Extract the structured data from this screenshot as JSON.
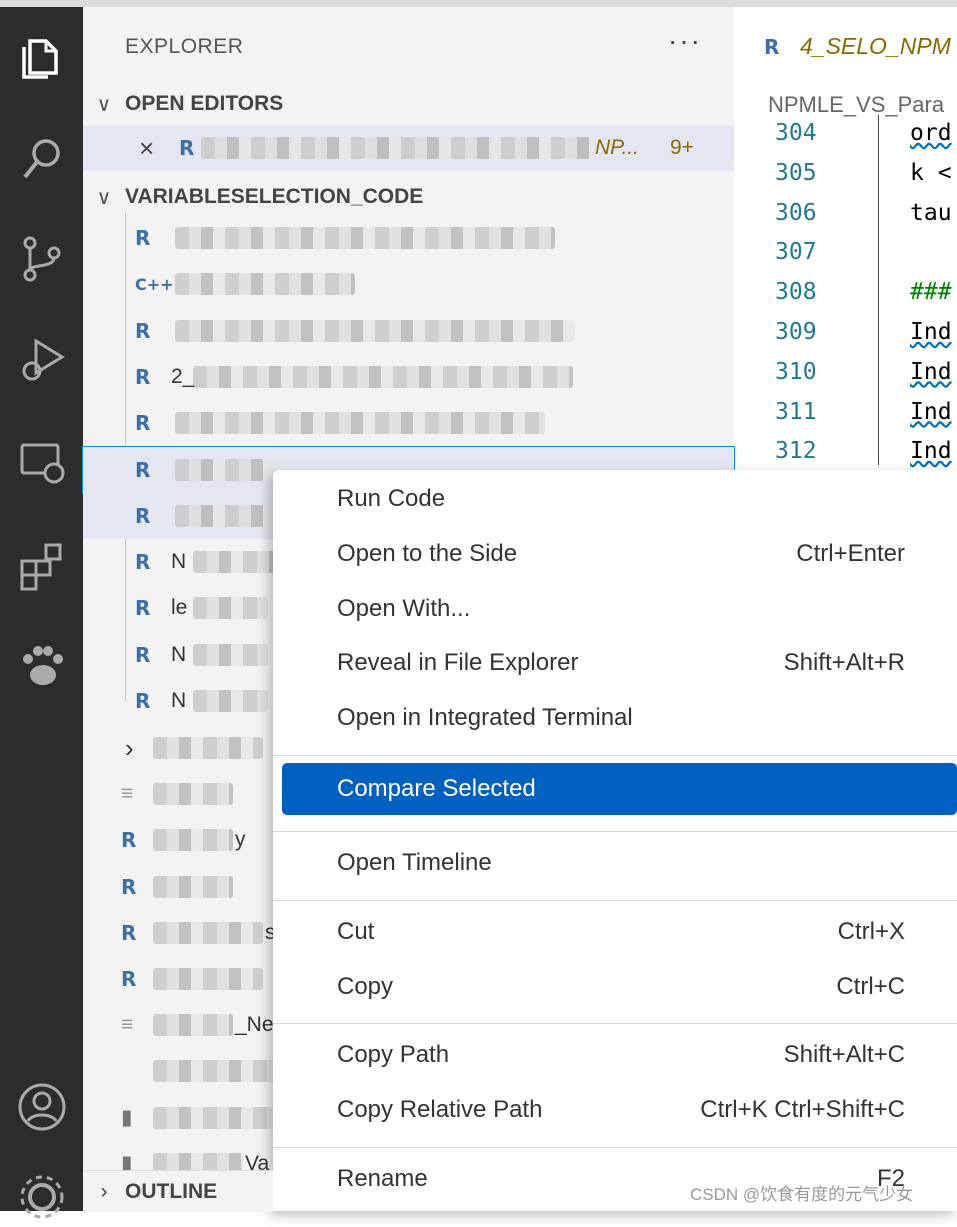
{
  "activity_bar": {
    "icons": [
      "explorer-icon",
      "search-icon",
      "source-control-icon",
      "run-debug-icon",
      "remote-explorer-icon",
      "extensions-icon",
      "paw-icon",
      "accounts-icon",
      "settings-icon"
    ]
  },
  "sidebar": {
    "title": "EXPLORER",
    "more": "···",
    "open_editors": {
      "label": "OPEN EDITORS",
      "item_suffix": "NP...",
      "item_badge": "9+"
    },
    "folder": {
      "label": "VARIABLESELECTION_CODE"
    },
    "files": [
      {
        "icon": "R",
        "text_visible": "",
        "blur": 380
      },
      {
        "icon": "C++",
        "text_visible": "",
        "blur": 180
      },
      {
        "icon": "R",
        "text_visible": "",
        "blur": 400
      },
      {
        "icon": "R",
        "text_visible": "2_",
        "blur": 380
      },
      {
        "icon": "R",
        "text_visible": "",
        "blur": 370
      },
      {
        "icon": "R",
        "text_visible": "",
        "blur": 100
      },
      {
        "icon": "R",
        "text_visible": "",
        "blur": 100
      },
      {
        "icon": "R",
        "text_visible": "N",
        "blur": 90
      },
      {
        "icon": "R",
        "text_visible": "le",
        "blur": 75
      },
      {
        "icon": "R",
        "text_visible": "N",
        "blur": 75
      },
      {
        "icon": "R",
        "text_visible": "N",
        "blur": 75
      }
    ],
    "lower_items": [
      {
        "icon": "chevron",
        "text": "",
        "blur": 110
      },
      {
        "icon": "lines",
        "text": "",
        "blur": 80
      },
      {
        "icon": "R",
        "text": "y",
        "blur": 80
      },
      {
        "icon": "R",
        "text": "",
        "blur": 80
      },
      {
        "icon": "R",
        "text": "s",
        "blur": 110
      },
      {
        "icon": "R",
        "text": "",
        "blur": 110
      },
      {
        "icon": "lines",
        "text": "_New",
        "blur": 80
      },
      {
        "icon": "none",
        "text": "",
        "blur": 150
      },
      {
        "icon": "lock",
        "text": "",
        "blur": 130
      },
      {
        "icon": "lock",
        "text": "Va",
        "blur": 90
      }
    ],
    "outline": "OUTLINE"
  },
  "editor": {
    "tab_title": "4_SELO_NPM",
    "breadcrumb": "NPMLE_VS_Para",
    "lines": [
      {
        "num": "304",
        "code": "ord"
      },
      {
        "num": "305",
        "code": "k <"
      },
      {
        "num": "306",
        "code": "tau"
      },
      {
        "num": "307",
        "code": ""
      },
      {
        "num": "308",
        "code": "###"
      },
      {
        "num": "309",
        "code": "Ind"
      },
      {
        "num": "310",
        "code": "Ind"
      },
      {
        "num": "311",
        "code": "Ind"
      },
      {
        "num": "312",
        "code": "Ind"
      }
    ]
  },
  "context_menu": {
    "groups": [
      [
        {
          "label": "Run Code",
          "key": ""
        },
        {
          "label": "Open to the Side",
          "key": "Ctrl+Enter"
        },
        {
          "label": "Open With...",
          "key": ""
        },
        {
          "label": "Reveal in File Explorer",
          "key": "Shift+Alt+R"
        },
        {
          "label": "Open in Integrated Terminal",
          "key": ""
        }
      ],
      [
        {
          "label": "Compare Selected",
          "key": "",
          "active": true
        }
      ],
      [
        {
          "label": "Open Timeline",
          "key": ""
        }
      ],
      [
        {
          "label": "Cut",
          "key": "Ctrl+X"
        },
        {
          "label": "Copy",
          "key": "Ctrl+C"
        }
      ],
      [
        {
          "label": "Copy Path",
          "key": "Shift+Alt+C"
        },
        {
          "label": "Copy Relative Path",
          "key": "Ctrl+K Ctrl+Shift+C"
        }
      ],
      [
        {
          "label": "Rename",
          "key": "F2"
        }
      ]
    ]
  },
  "watermark": "CSDN @饮食有度的元气少女",
  "colors": {
    "accent": "#0060c0",
    "activity_bg": "#2c2c2c",
    "sidebar_bg": "#f3f3f3",
    "line_number": "#237893"
  }
}
